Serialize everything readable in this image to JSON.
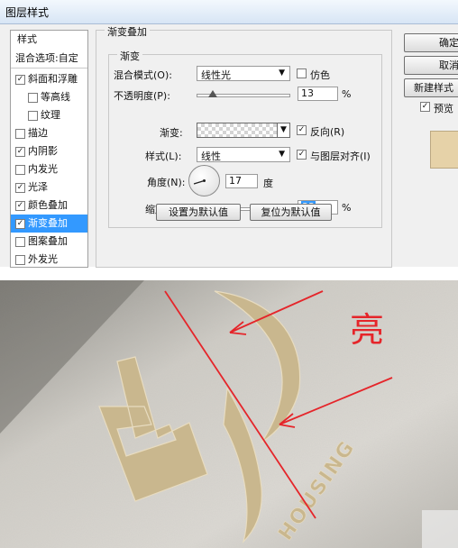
{
  "window": {
    "title": "图层样式"
  },
  "sidebar": {
    "header": "样式",
    "blend_options": "混合选项:自定",
    "items": [
      {
        "label": "斜面和浮雕",
        "checked": "✓"
      },
      {
        "label": "等高线",
        "checked": ""
      },
      {
        "label": "纹理",
        "checked": ""
      },
      {
        "label": "描边",
        "checked": ""
      },
      {
        "label": "内阴影",
        "checked": "✓"
      },
      {
        "label": "内发光",
        "checked": ""
      },
      {
        "label": "光泽",
        "checked": "✓"
      },
      {
        "label": "颜色叠加",
        "checked": "✓"
      },
      {
        "label": "渐变叠加",
        "checked": "✓"
      },
      {
        "label": "图案叠加",
        "checked": ""
      },
      {
        "label": "外发光",
        "checked": ""
      }
    ]
  },
  "panel": {
    "title": "渐变叠加",
    "group_title": "渐变",
    "blend_mode": {
      "label": "混合模式(O):",
      "value": "线性光"
    },
    "dither": {
      "label": "仿色",
      "checked": ""
    },
    "opacity": {
      "label": "不透明度(P):",
      "value": "13",
      "unit": "%",
      "fraction": 0.13
    },
    "gradient": {
      "label": "渐变:"
    },
    "reverse": {
      "label": "反向(R)",
      "checked": "✓"
    },
    "style": {
      "label": "样式(L):",
      "value": "线性"
    },
    "align": {
      "label": "与图层对齐(I)",
      "checked": "✓"
    },
    "angle": {
      "label": "角度(N):",
      "value": "17",
      "unit": "度"
    },
    "scale": {
      "label": "缩放(S):",
      "value": "33",
      "unit": "%",
      "fraction": 0.33
    },
    "set_default": "设置为默认值",
    "reset_default": "复位为默认值"
  },
  "right_buttons": {
    "ok": "确定",
    "cancel": "取消",
    "new_style": "新建样式",
    "preview": "预览",
    "preview_checked": "✓"
  },
  "photo": {
    "annotation": "亮",
    "logo_text": "HOUSING",
    "colors": {
      "paper": "#d9d6d0",
      "gold": "#c7b48a",
      "annotation": "#e5252a"
    }
  }
}
